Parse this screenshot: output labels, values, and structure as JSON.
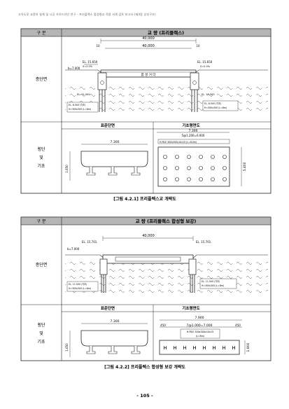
{
  "header_text": "고속도로 교량의 설계 및 시공 가이드라인 연구 - 프리플렉스 합성형교 적용 사례 검토 보고서 (제4장 상부구조)",
  "fig1": {
    "col_label": "구 분",
    "title": "교 량 (프리플렉스)",
    "row1_label": "종단면",
    "row2_label": [
      "횡단",
      "및",
      "기초"
    ],
    "dims": {
      "total": "40,000",
      "span": "40,000",
      "left": "10",
      "right": "10"
    },
    "el_left": "EL. 15.650",
    "el_right": "EL. 15.650",
    "slope_left": "S=2.0%",
    "slope_right": "S=2.0%",
    "bent": "b=7.000",
    "deck_label": "합 성 거 더",
    "pile_left": "EL. 11.500",
    "pile_right": "EL. 11.500",
    "found_left": [
      "EL. 8.500 (기초)",
      "H=300x300 (L=8m)"
    ],
    "found_right": [
      "EL. 8.500 (기초)",
      "H=300x300 (L=8m)"
    ],
    "sub_left_title": "표준단면",
    "sub_right_title": "기초평면도",
    "cs_width": "7.300",
    "cs_height": "1.650",
    "plan_width": "7.300",
    "plan_spacing": "5@1.200=6.000",
    "plan_note": "H-PILE 300x300x10x15 (L=8.0m)",
    "plan_height": "5.400",
    "caption": "[그림 4.2.1] 프리플렉스교 개략도"
  },
  "fig2": {
    "col_label": "구 분",
    "title": "교 량 (프리플렉스 합성형 보강)",
    "row1_label": "종단면",
    "row2_label": [
      "횡단",
      "및",
      "기초"
    ],
    "dims": {
      "total": "40,000"
    },
    "el_left": "EL. 15.701",
    "el_right": "EL. 15.701",
    "bent": "b=7.000",
    "found_left": [
      "EL. 11.500 (기초)",
      "H=300x300 (L=8m)"
    ],
    "found_right": [
      "EL. 11.500 (기초)",
      "H=300x300 (L=8m)"
    ],
    "sub_left_title": "표준단면",
    "sub_right_title": "기초평면도",
    "cs_width": "7.300",
    "cs_height": "1.650",
    "plan_width": "7.900",
    "plan_left": "450",
    "plan_mid": "7@1.000=7.000",
    "plan_right": "450",
    "plan_note": [
      "H-PILE 300x300x10x15",
      "(L=8m)"
    ],
    "plan_height": "1.800",
    "caption": "[그림 4.2.2] 프리플렉스 합성형 보강 개략도"
  },
  "page_number": "- 105 -"
}
